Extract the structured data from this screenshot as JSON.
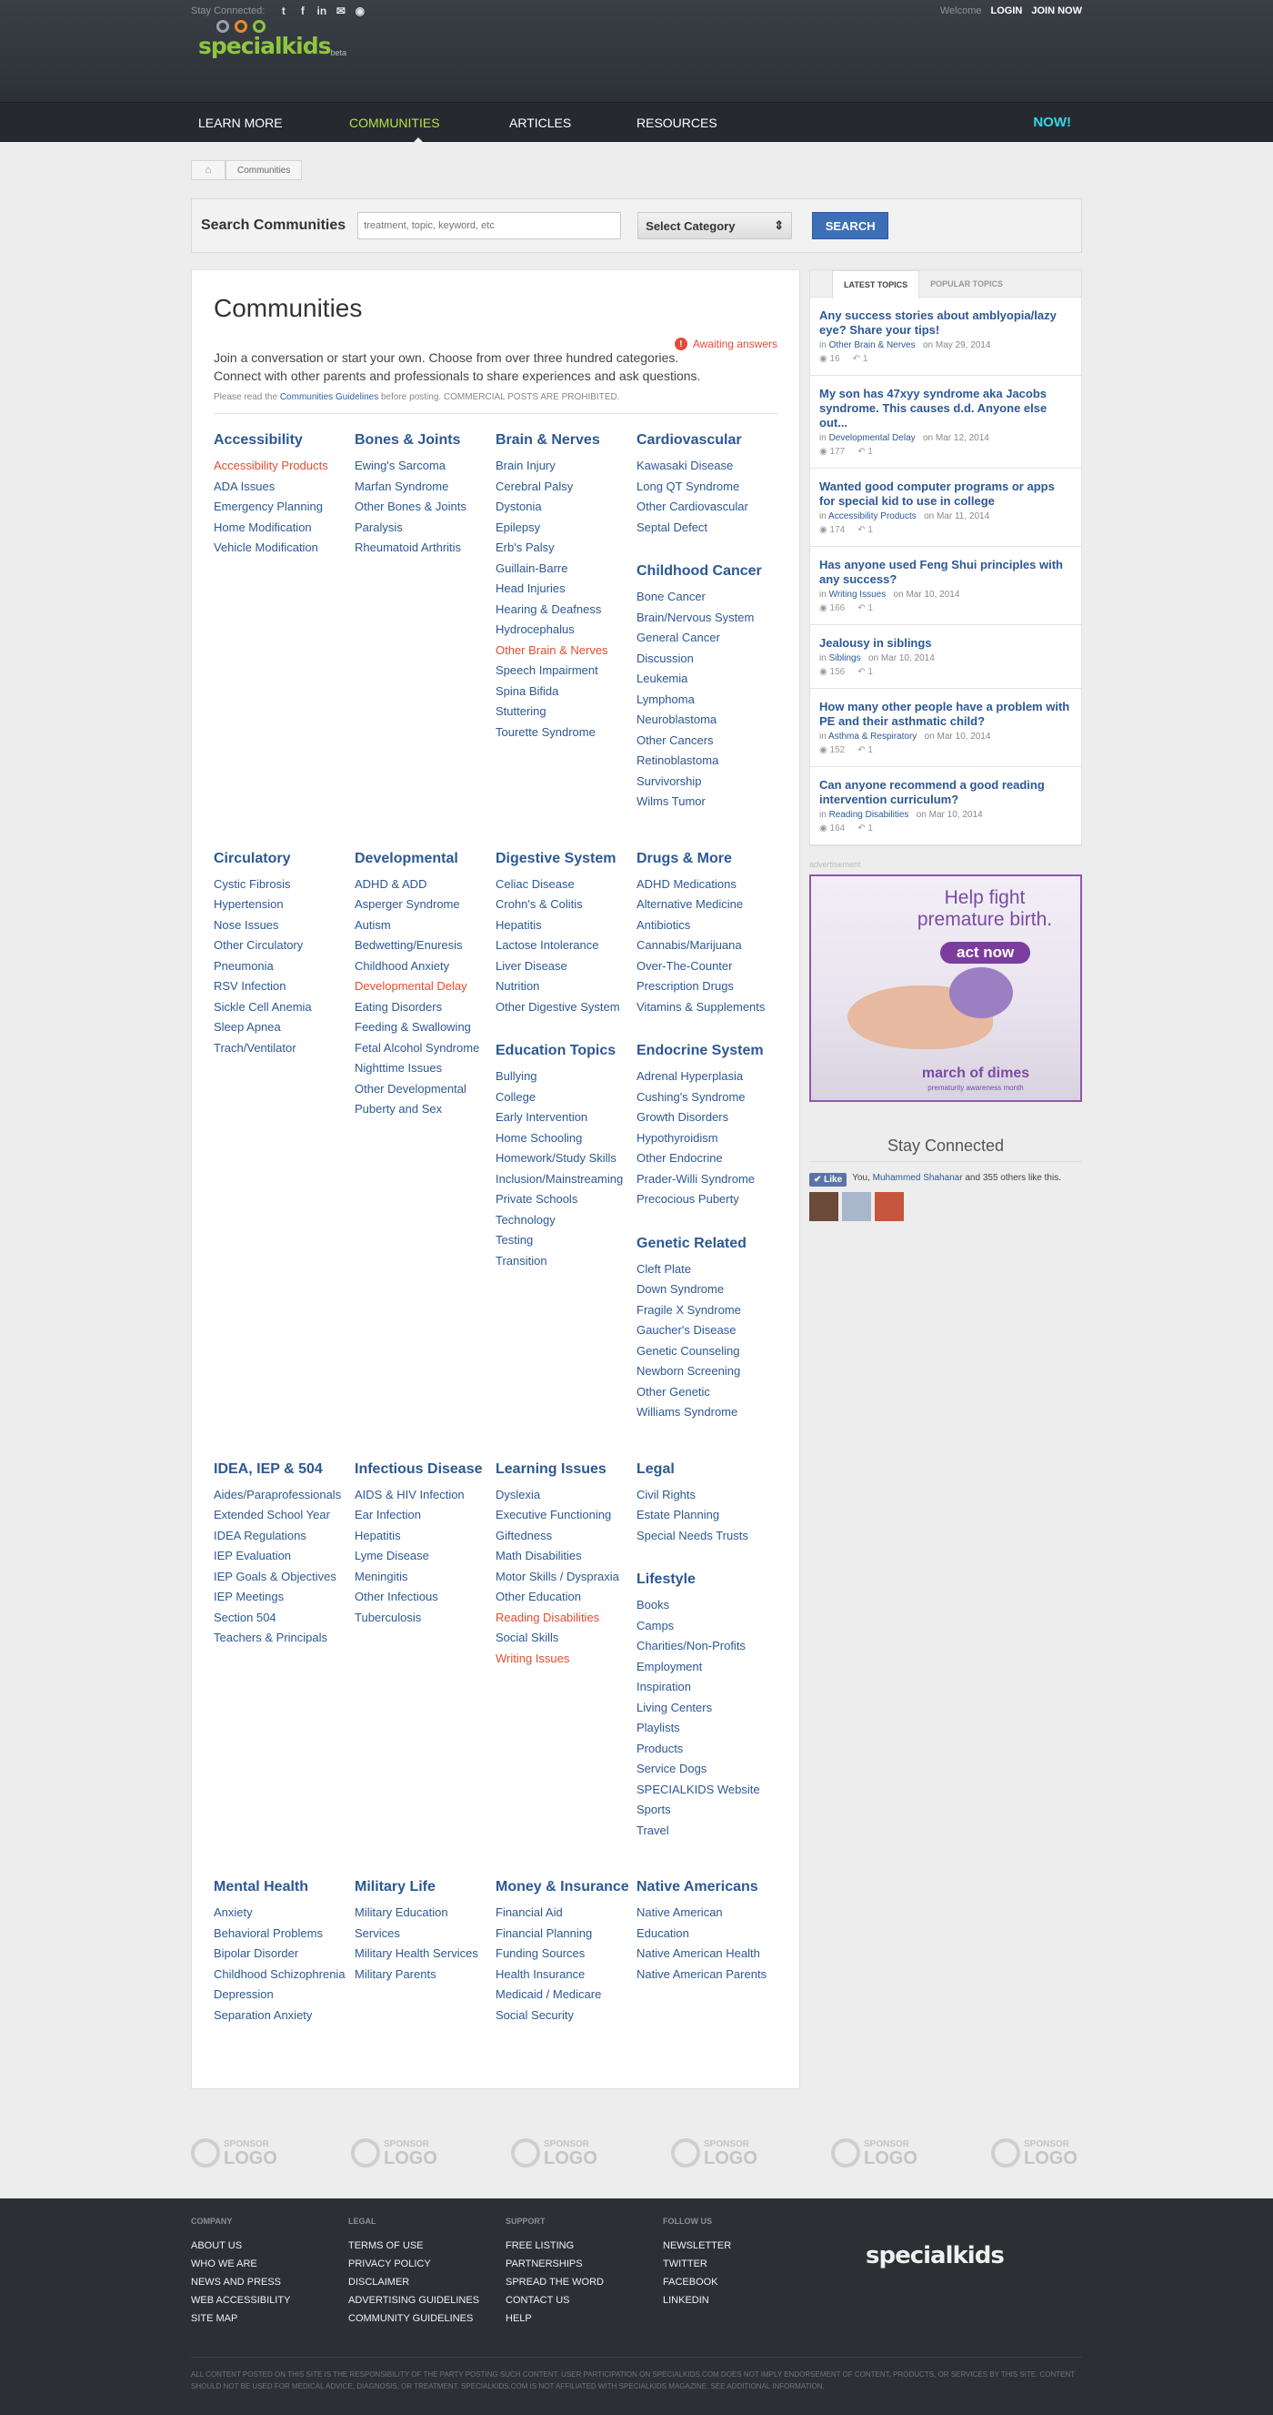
{
  "topbar": {
    "stay_label": "Stay Connected:",
    "social": [
      "t",
      "f",
      "in",
      "✉",
      "◉"
    ],
    "welcome": "Welcome",
    "login": "LOGIN",
    "join": "JOIN NOW"
  },
  "logo": {
    "text": "specialkids",
    "beta": "beta"
  },
  "nav": {
    "items": [
      "LEARN MORE",
      "COMMUNITIES",
      "ARTICLES",
      "RESOURCES"
    ],
    "now": "NOW!"
  },
  "breadcrumb": {
    "current": "Communities"
  },
  "search": {
    "label": "Search Communities",
    "placeholder": "treatment, topic, keyword, etc",
    "category": "Select Category",
    "button": "SEARCH"
  },
  "main": {
    "title": "Communities",
    "awaiting": "Awaiting answers",
    "intro1": "Join a conversation or start your own. Choose from over three hundred categories.",
    "intro2": "Connect with other parents and professionals to share experiences and ask questions.",
    "note_pre": "Please read the ",
    "note_link": "Communities Guidelines",
    "note_post": " before posting. COMMERCIAL POSTS ARE PROHIBITED."
  },
  "columns": [
    [
      {
        "title": "Accessibility",
        "items": [
          "Accessibility Products",
          "ADA Issues",
          "Emergency Planning",
          "Home Modification",
          "Vehicle Modification"
        ],
        "red": [
          0
        ]
      }
    ],
    [
      {
        "title": "Bones & Joints",
        "items": [
          "Ewing's Sarcoma",
          "Marfan Syndrome",
          "Other Bones & Joints",
          "Paralysis",
          "Rheumatoid Arthritis"
        ],
        "red": []
      }
    ],
    [
      {
        "title": "Brain & Nerves",
        "items": [
          "Brain Injury",
          "Cerebral Palsy",
          "Dystonia",
          "Epilepsy",
          "Erb's Palsy",
          "Guillain-Barre",
          "Head Injuries",
          "Hearing & Deafness",
          "Hydrocephalus",
          "Other Brain & Nerves",
          "Speech Impairment",
          "Spina Bifida",
          "Stuttering",
          "Tourette Syndrome"
        ],
        "red": [
          9
        ]
      }
    ],
    [
      {
        "title": "Cardiovascular",
        "items": [
          "Kawasaki Disease",
          "Long QT Syndrome",
          "Other Cardiovascular",
          "Septal Defect"
        ],
        "red": []
      },
      {
        "title": "Childhood Cancer",
        "items": [
          "Bone Cancer",
          "Brain/Nervous System",
          "General Cancer",
          "Discussion",
          "Leukemia",
          "Lymphoma",
          "Neuroblastoma",
          "Other Cancers",
          "Retinoblastoma",
          "Survivorship",
          "Wilms Tumor"
        ],
        "red": []
      }
    ],
    [
      {
        "title": "Circulatory",
        "items": [
          "Cystic Fibrosis",
          "Hypertension",
          "Nose Issues",
          "Other Circulatory",
          "Pneumonia",
          "RSV Infection",
          "Sickle Cell Anemia",
          "Sleep Apnea",
          "Trach/Ventilator"
        ],
        "red": []
      }
    ],
    [
      {
        "title": "Developmental",
        "items": [
          "ADHD & ADD",
          "Asperger Syndrome",
          "Autism",
          "Bedwetting/Enuresis",
          "Childhood Anxiety",
          "Developmental Delay",
          "Eating Disorders",
          "Feeding & Swallowing",
          "Fetal Alcohol Syndrome",
          "Nighttime Issues",
          "Other Developmental",
          "Puberty and Sex"
        ],
        "red": [
          5
        ]
      }
    ],
    [
      {
        "title": "Digestive System",
        "items": [
          "Celiac Disease",
          "Crohn's & Colitis",
          "Hepatitis",
          "Lactose Intolerance",
          "Liver Disease",
          "Nutrition",
          "Other Digestive System"
        ],
        "red": []
      },
      {
        "title": "Education Topics",
        "items": [
          "Bullying",
          "College",
          "Early Intervention",
          "Home Schooling",
          "Homework/Study Skills",
          "Inclusion/Mainstreaming",
          "Private Schools",
          "Technology",
          "Testing",
          "Transition"
        ],
        "red": []
      }
    ],
    [
      {
        "title": "Drugs & More",
        "items": [
          "ADHD Medications",
          "Alternative Medicine",
          "Antibiotics",
          "Cannabis/Marijuana",
          "Over-The-Counter",
          "Prescription Drugs",
          "Vitamins & Supplements"
        ],
        "red": []
      },
      {
        "title": "Endocrine System",
        "items": [
          "Adrenal Hyperplasia",
          "Cushing's Syndrome",
          "Growth Disorders",
          "Hypothyroidism",
          "Other Endocrine",
          "Prader-Willi Syndrome",
          "Precocious Puberty"
        ],
        "red": []
      },
      {
        "title": "Genetic Related",
        "items": [
          "Cleft Plate",
          "Down Syndrome",
          "Fragile X Syndrome",
          "Gaucher's Disease",
          "Genetic Counseling",
          "Newborn Screening",
          "Other Genetic",
          "Williams Syndrome"
        ],
        "red": []
      }
    ],
    [
      {
        "title": "IDEA, IEP & 504",
        "items": [
          "Aides/Paraprofessionals",
          "Extended School Year",
          "IDEA Regulations",
          "IEP Evaluation",
          "IEP Goals & Objectives",
          "IEP Meetings",
          "Section 504",
          "Teachers & Principals"
        ],
        "red": []
      }
    ],
    [
      {
        "title": "Infectious Disease",
        "items": [
          "AIDS & HIV Infection",
          "Ear Infection",
          "Hepatitis",
          "Lyme Disease",
          "Meningitis",
          "Other Infectious",
          "Tuberculosis"
        ],
        "red": []
      }
    ],
    [
      {
        "title": "Learning Issues",
        "items": [
          "Dyslexia",
          "Executive Functioning",
          "Giftedness",
          "Math Disabilities",
          "Motor Skills / Dyspraxia",
          "Other Education",
          "Reading Disabilities",
          "Social Skills",
          "Writing Issues"
        ],
        "red": [
          6,
          8
        ]
      }
    ],
    [
      {
        "title": "Legal",
        "items": [
          "Civil Rights",
          "Estate Planning",
          "Special Needs Trusts"
        ],
        "red": []
      },
      {
        "title": "Lifestyle",
        "items": [
          "Books",
          "Camps",
          "Charities/Non-Profits",
          "Employment",
          "Inspiration",
          "Living Centers",
          "Playlists",
          "Products",
          "Service Dogs",
          "SPECIALKIDS Website",
          "Sports",
          "Travel"
        ],
        "red": []
      }
    ],
    [
      {
        "title": "Mental Health",
        "items": [
          "Anxiety",
          "Behavioral Problems",
          "Bipolar Disorder",
          "Childhood Schizophrenia",
          "Depression",
          "Separation Anxiety"
        ],
        "red": []
      }
    ],
    [
      {
        "title": "Military Life",
        "items": [
          "Military Education",
          "Services",
          "Military Health Services",
          "Military Parents"
        ],
        "red": []
      }
    ],
    [
      {
        "title": "Money & Insurance",
        "items": [
          "Financial Aid",
          "Financial Planning",
          "Funding Sources",
          "Health Insurance",
          "Medicaid / Medicare",
          "Social Security"
        ],
        "red": []
      }
    ],
    [
      {
        "title": "Native Americans",
        "items": [
          "Native American",
          "Education",
          "Native American Health",
          "Native American Parents"
        ],
        "red": []
      }
    ]
  ],
  "sidebar": {
    "tabs": [
      "LATEST TOPICS",
      "POPULAR TOPICS"
    ],
    "topics": [
      {
        "title": "Any success stories about amblyopia/lazy eye? Share your tips!",
        "cat": "Other Brain & Nerves",
        "date": "on May 29, 2014",
        "views": "16",
        "replies": "1"
      },
      {
        "title": "My son has 47xyy syndrome aka Jacobs syndrome. This causes d.d. Anyone else out...",
        "cat": "Developmental Delay",
        "date": "on Mar 12, 2014",
        "views": "177",
        "replies": "1"
      },
      {
        "title": "Wanted good computer programs or apps for special kid to use in college",
        "cat": "Accessibility Products",
        "date": "on Mar 11, 2014",
        "views": "174",
        "replies": "1"
      },
      {
        "title": "Has anyone used Feng Shui principles with any success?",
        "cat": "Writing Issues",
        "date": "on Mar 10, 2014",
        "views": "166",
        "replies": "1"
      },
      {
        "title": "Jealousy in siblings",
        "cat": "Siblings",
        "date": "on Mar 10, 2014",
        "views": "156",
        "replies": "1"
      },
      {
        "title": "How many other people have a problem with PE and their asthmatic child?",
        "cat": "Asthma & Respiratory",
        "date": "on Mar 10, 2014",
        "views": "152",
        "replies": "1"
      },
      {
        "title": "Can anyone recommend a good reading intervention curriculum?",
        "cat": "Reading Disabilities",
        "date": "on Mar 10, 2014",
        "views": "164",
        "replies": "1"
      }
    ],
    "in_label": "in",
    "ad_label": "advertisement",
    "ad": {
      "headline": "Help fight premature birth.",
      "cta": "act now",
      "brand": "march of dimes",
      "sub": "prematurity awareness month"
    },
    "stay": "Stay Connected",
    "fb": {
      "like": "Like",
      "pre": "You, ",
      "name": "Muhammed Shahanar",
      "post": " and 355 others like this."
    }
  },
  "sponsors": [
    "SPONSOR",
    "LOGO"
  ],
  "footer": {
    "cols": [
      {
        "h": "COMPANY",
        "items": [
          "ABOUT US",
          "WHO WE ARE",
          "NEWS AND PRESS",
          "WEB ACCESSIBILITY",
          "SITE MAP"
        ]
      },
      {
        "h": "LEGAL",
        "items": [
          "TERMS OF USE",
          "PRIVACY POLICY",
          "DISCLAIMER",
          "ADVERTISING GUIDELINES",
          "COMMUNITY GUIDELINES"
        ]
      },
      {
        "h": "SUPPORT",
        "items": [
          "FREE LISTING",
          "PARTNERSHIPS",
          "SPREAD THE WORD",
          "CONTACT US",
          "HELP"
        ]
      },
      {
        "h": "FOLLOW US",
        "items": [
          "NEWSLETTER",
          "TWITTER",
          "FACEBOOK",
          "LINKEDIN"
        ]
      }
    ],
    "logo": "specialkids",
    "legal": "ALL CONTENT POSTED ON THIS SITE IS THE RESPONSIBILITY OF THE PARTY POSTING SUCH CONTENT. USER PARTICIPATION ON SPECIALKIDS.COM DOES NOT IMPLY ENDORSEMENT OF CONTENT, PRODUCTS, OR SERVICES BY THIS SITE. CONTENT SHOULD NOT BE USED FOR MEDICAL ADVICE, DIAGNOSIS, OR TREATMENT. SPECIALKIDS.COM IS NOT AFFILIATED WITH SPECIALKIDS MAGAZINE. SEE ADDITIONAL INFORMATION."
  }
}
